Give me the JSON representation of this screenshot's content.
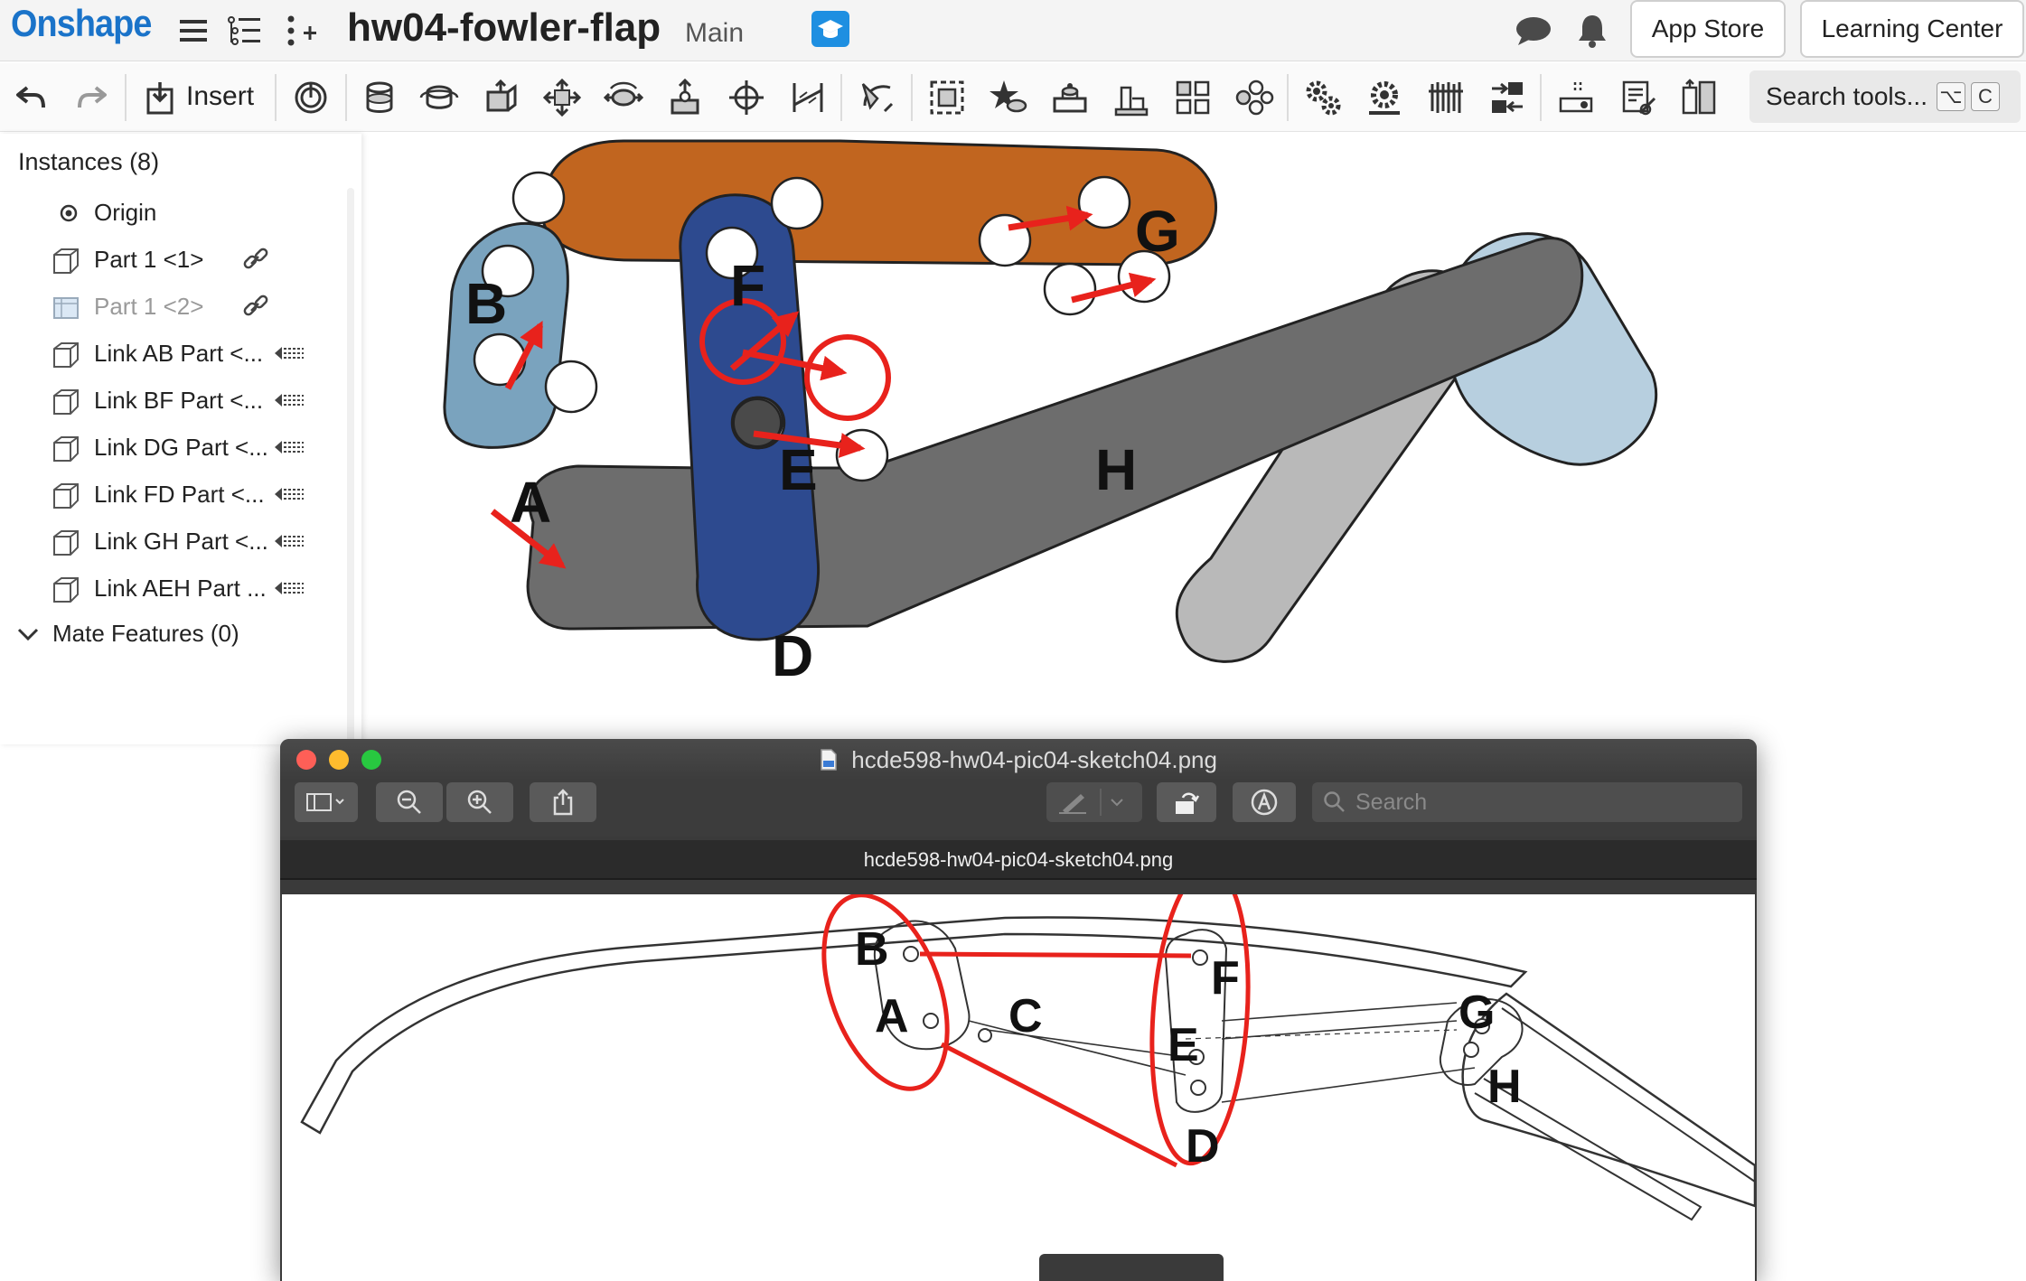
{
  "app": {
    "logo": "Onshape",
    "document_title": "hw04-fowler-flap",
    "branch": "Main",
    "app_store_label": "App Store",
    "learning_center_label": "Learning Center"
  },
  "toolbar": {
    "insert_label": "Insert",
    "search_label": "Search tools...",
    "shortcut_keys": [
      "⌥",
      "C"
    ]
  },
  "instances": {
    "title": "Instances (8)",
    "items": [
      {
        "label": "Origin",
        "icon": "origin-icon"
      },
      {
        "label": "Part 1 <1>",
        "icon": "part-icon",
        "side": "link-icon"
      },
      {
        "label": "Part 1 <2>",
        "icon": "part-icon",
        "side": "link-icon",
        "dimmed": true
      },
      {
        "label": "Link AB Part <...",
        "icon": "part-icon",
        "side": "derived-icon"
      },
      {
        "label": "Link BF Part <...",
        "icon": "part-icon",
        "side": "derived-icon"
      },
      {
        "label": "Link DG Part <...",
        "icon": "part-icon",
        "side": "derived-icon"
      },
      {
        "label": "Link FD Part <...",
        "icon": "part-icon",
        "side": "derived-icon"
      },
      {
        "label": "Link GH Part <...",
        "icon": "part-icon",
        "side": "derived-icon"
      },
      {
        "label": "Link AEH Part ...",
        "icon": "part-icon",
        "side": "derived-icon"
      }
    ],
    "mate_features_label": "Mate Features (0)"
  },
  "viewport_labels": {
    "a": "A",
    "b": "B",
    "d": "D",
    "e": "E",
    "f": "F",
    "g": "G",
    "h": "H"
  },
  "colors": {
    "brand_blue": "#1a73c9",
    "link_orange": "#c1651f",
    "link_light_blue": "#7aa3be",
    "link_navy": "#2d4a8f",
    "link_dark_gray": "#6c6c6c",
    "link_light_gray": "#b7b7b7",
    "link_pale_blue": "#b7cfdf",
    "annotation_red": "#e8221c"
  },
  "preview": {
    "window_title": "hcde598-hw04-pic04-sketch04.png",
    "tab_title": "hcde598-hw04-pic04-sketch04.png",
    "search_placeholder": "Search",
    "sketch_labels": {
      "b": "B",
      "f": "F",
      "a": "A",
      "c": "C",
      "e": "E",
      "g": "G",
      "h": "H",
      "d": "D"
    }
  }
}
